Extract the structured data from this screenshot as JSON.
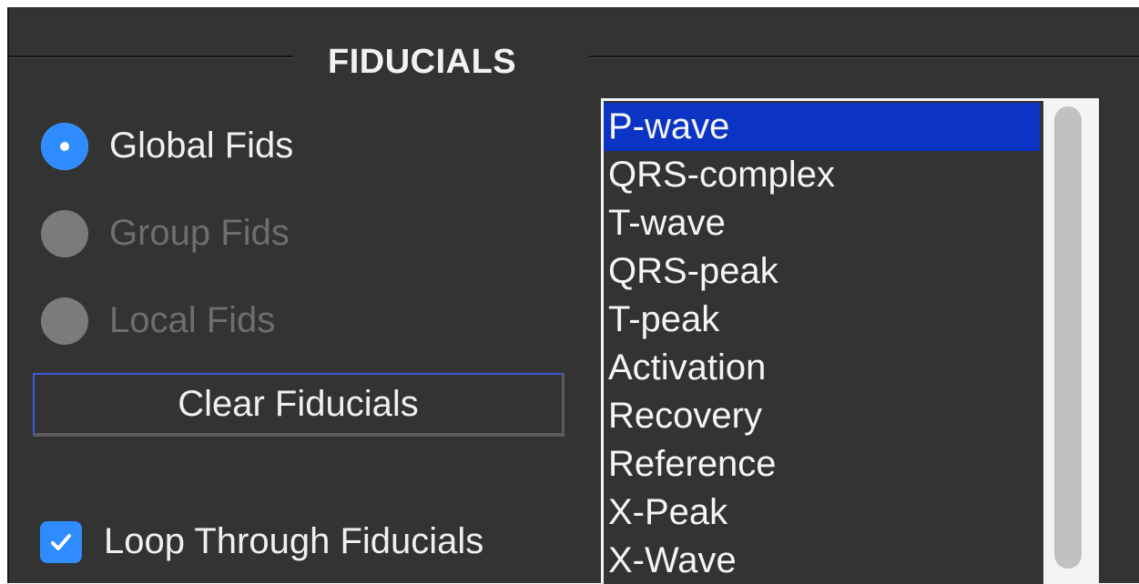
{
  "group": {
    "title": "FIDUCIALS"
  },
  "scope_options": [
    {
      "label": "Global Fids",
      "selected": true,
      "enabled": true
    },
    {
      "label": "Group Fids",
      "selected": false,
      "enabled": false
    },
    {
      "label": "Local Fids",
      "selected": false,
      "enabled": false
    }
  ],
  "clear_button": {
    "label": "Clear Fiducials"
  },
  "loop_checkbox": {
    "label": "Loop Through Fiducials",
    "checked": true
  },
  "fiducial_list": {
    "selected_index": 0,
    "items": [
      "P-wave",
      "QRS-complex",
      "T-wave",
      "QRS-peak",
      "T-peak",
      "Activation",
      "Recovery",
      "Reference",
      "X-Peak",
      "X-Wave"
    ]
  },
  "colors": {
    "panel_bg": "#333333",
    "accent_blue": "#2f8cff",
    "selection_blue": "#0b33c4",
    "text": "#f0f0f0",
    "disabled_text": "#6e6e6e"
  }
}
